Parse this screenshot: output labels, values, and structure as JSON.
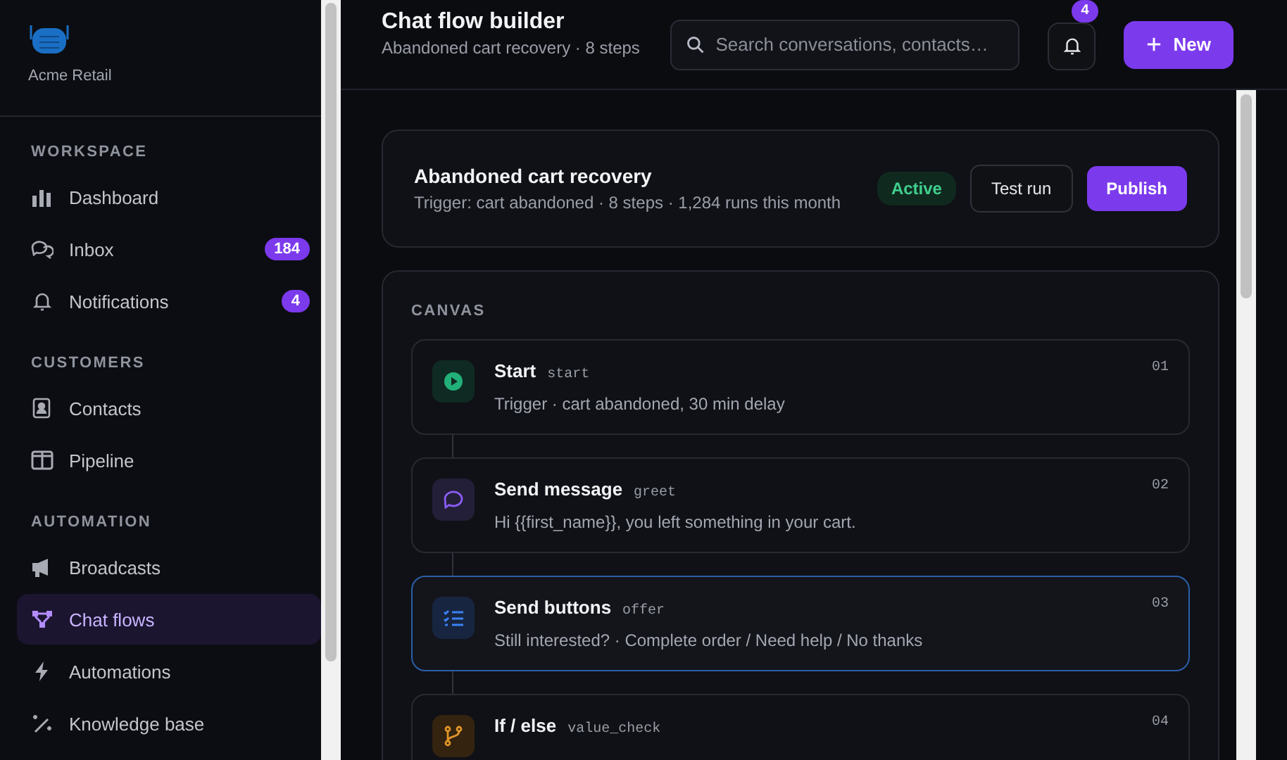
{
  "sidebar": {
    "org": "Acme Retail",
    "sections": [
      {
        "title": "WORKSPACE",
        "items": [
          {
            "label": "Dashboard",
            "selected": false
          },
          {
            "label": "Inbox",
            "badge": "184",
            "selected": false
          },
          {
            "label": "Notifications",
            "badge": "4",
            "selected": false
          }
        ]
      },
      {
        "title": "CUSTOMERS",
        "items": [
          {
            "label": "Contacts",
            "selected": false
          },
          {
            "label": "Pipeline",
            "selected": false
          }
        ]
      },
      {
        "title": "AUTOMATION",
        "items": [
          {
            "label": "Broadcasts",
            "selected": false
          },
          {
            "label": "Chat flows",
            "selected": true
          },
          {
            "label": "Automations",
            "selected": false
          },
          {
            "label": "Knowledge base",
            "selected": false
          }
        ]
      }
    ]
  },
  "header": {
    "title": "Chat flow builder",
    "subtitle": "Abandoned cart recovery · 8 steps",
    "search": {
      "placeholder": "Search conversations, contacts…"
    },
    "notifications": "4",
    "new_button": "New"
  },
  "flow": {
    "title": "Abandoned cart recovery",
    "meta": "Trigger: cart abandoned · 8 steps · 1,284 runs this month",
    "status": "Active",
    "test_button": "Test run",
    "publish_button": "Publish"
  },
  "canvas": {
    "label": "CANVAS",
    "steps": [
      {
        "kind": "start",
        "title": "Start",
        "key": "start",
        "detail": "Trigger · cart abandoned, 30 min delay",
        "number": "01",
        "selected": false
      },
      {
        "kind": "message",
        "title": "Send message",
        "key": "greet",
        "detail": "Hi {{first_name}}, you left something in your cart.",
        "number": "02",
        "selected": false
      },
      {
        "kind": "buttons",
        "title": "Send buttons",
        "key": "offer",
        "detail": "Still interested? · Complete order / Need help / No thanks",
        "number": "03",
        "selected": true
      },
      {
        "kind": "branch",
        "title": "If / else",
        "key": "value_check",
        "number": "04",
        "selected": false
      }
    ]
  }
}
